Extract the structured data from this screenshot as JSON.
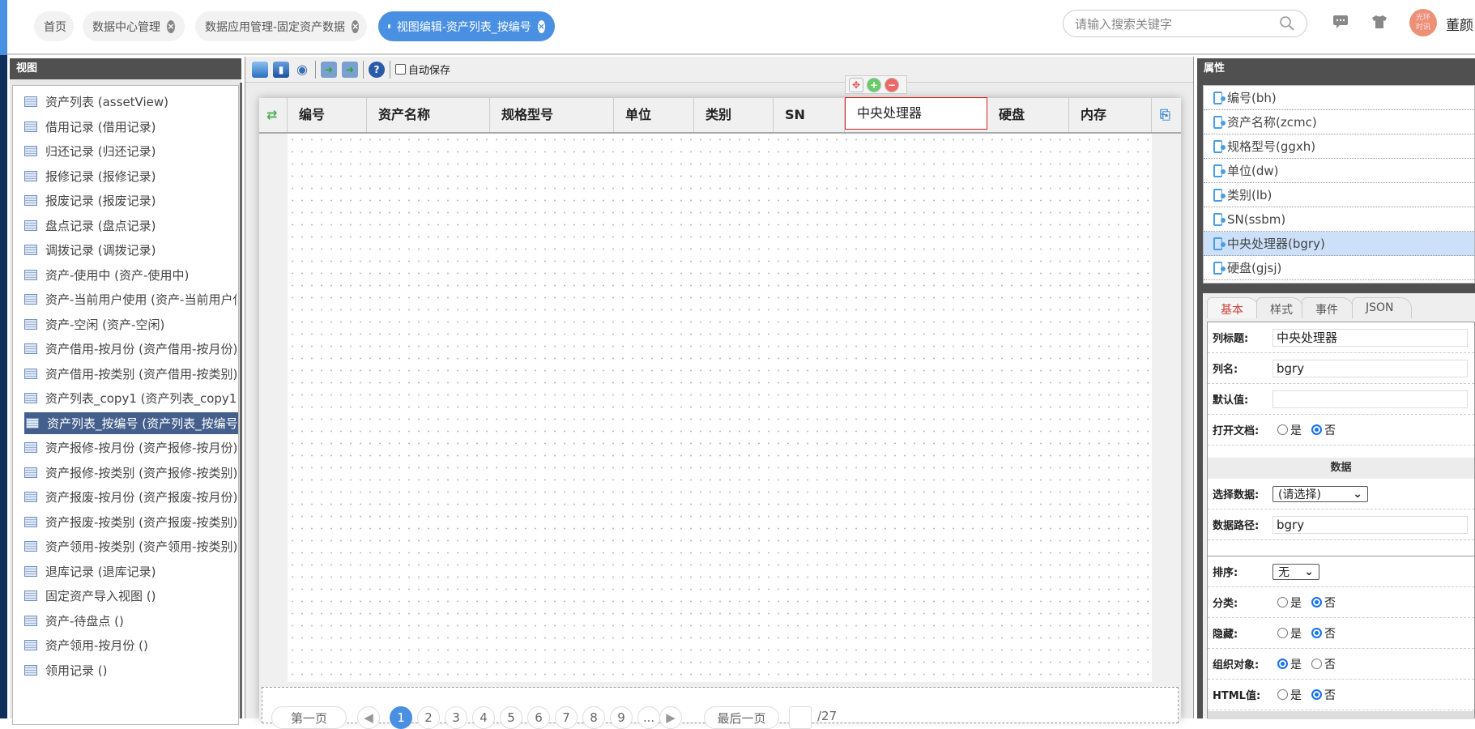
{
  "tabs": [
    {
      "label": "首页",
      "closable": false,
      "active": false
    },
    {
      "label": "数据中心管理",
      "closable": true,
      "active": false
    },
    {
      "label": "数据应用管理-固定资产数据",
      "closable": true,
      "active": false
    },
    {
      "label": "视图编辑-资产列表_按编号",
      "closable": true,
      "active": true
    }
  ],
  "header": {
    "search_placeholder": "请输入搜索关键字",
    "avatar_text": "光环时讯",
    "user_name": "董颜"
  },
  "left_panel": {
    "title": "视图",
    "selected_index": 13,
    "items": [
      "资产列表 (assetView)",
      "借用记录 (借用记录)",
      "归还记录 (归还记录)",
      "报修记录 (报修记录)",
      "报废记录 (报废记录)",
      "盘点记录 (盘点记录)",
      "调拨记录 (调拨记录)",
      "资产-使用中 (资产-使用中)",
      "资产-当前用户使用 (资产-当前用户使用)",
      "资产-空闲 (资产-空闲)",
      "资产借用-按月份 (资产借用-按月份)",
      "资产借用-按类别 (资产借用-按类别)",
      "资产列表_copy1 (资产列表_copy1)",
      "资产列表_按编号 (资产列表_按编号)",
      "资产报修-按月份 (资产报修-按月份)",
      "资产报修-按类别 (资产报修-按类别)",
      "资产报废-按月份 (资产报废-按月份)",
      "资产报废-按类别 (资产报废-按类别)",
      "资产领用-按类别 (资产领用-按类别)",
      "退库记录 (退库记录)",
      "固定资产导入视图 ()",
      "资产-待盘点 ()",
      "资产领用-按月份 ()",
      "领用记录 ()"
    ]
  },
  "toolbar": {
    "autosave_label": "自动保存",
    "autosave_checked": false
  },
  "grid": {
    "columns": [
      "编号",
      "资产名称",
      "规格型号",
      "单位",
      "类别",
      "SN",
      "中央处理器",
      "硬盘",
      "内存"
    ],
    "selected_column": 6
  },
  "pager": {
    "first": "第一页",
    "last": "最后一页",
    "pages": [
      "1",
      "2",
      "3",
      "4",
      "5",
      "6",
      "7",
      "8",
      "9",
      "..."
    ],
    "current": "1",
    "total": "/27",
    "page_input": ""
  },
  "right_panel": {
    "title": "属性",
    "fields": [
      "编号(bh)",
      "资产名称(zcmc)",
      "规格型号(ggxh)",
      "单位(dw)",
      "类别(lb)",
      "SN(ssbm)",
      "中央处理器(bgry)",
      "硬盘(gjsj)"
    ],
    "selected_field": 6,
    "tabs": [
      "基本",
      "样式",
      "事件",
      "JSON"
    ],
    "active_tab": 0,
    "form": {
      "col_title_label": "列标题:",
      "col_title_value": "中央处理器",
      "col_name_label": "列名:",
      "col_name_value": "bgry",
      "default_label": "默认值:",
      "default_value": "",
      "open_doc_label": "打开文档:",
      "data_section": "数据",
      "select_data_label": "选择数据:",
      "select_data_value": "(请选择)",
      "data_path_label": "数据路径:",
      "data_path_value": "bgry",
      "sort_label": "排序:",
      "sort_value": "无",
      "category_label": "分类:",
      "hidden_label": "隐藏:",
      "org_label": "组织对象:",
      "html_label": "HTML值:",
      "yes": "是",
      "no": "否",
      "open_doc": "否",
      "category": "否",
      "hidden": "否",
      "org": "是",
      "html": "否"
    }
  },
  "colors": {
    "accent": "#4a90e2",
    "selected_view": "#445f8c",
    "selected_field": "#cce0fa",
    "header_dark": "#505050"
  }
}
